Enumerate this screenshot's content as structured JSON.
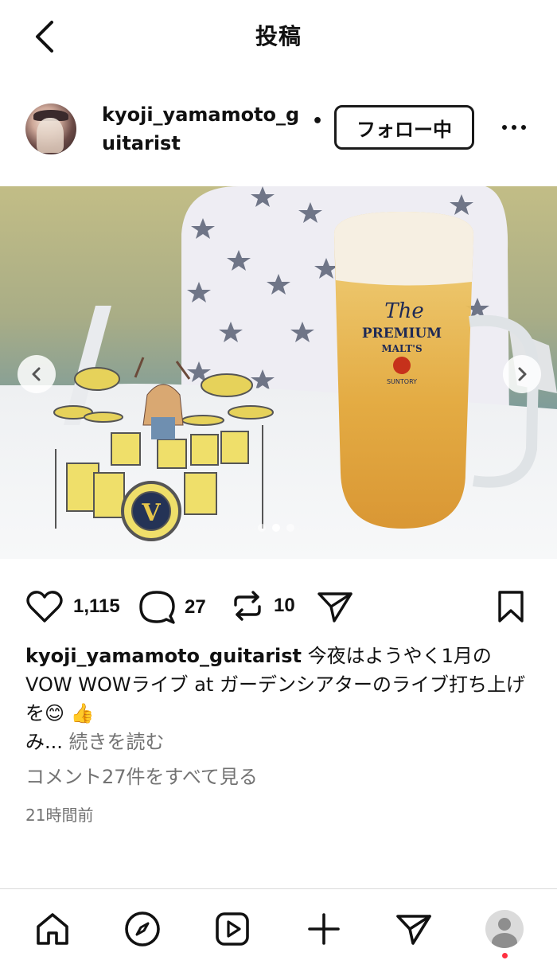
{
  "header": {
    "title": "投稿",
    "back_icon": "chevron-left-icon"
  },
  "post": {
    "username": "kyoji_yamamoto_guitarist",
    "separator": "•",
    "follow_label": "フォロー中",
    "more_icon": "more-horizontal-icon"
  },
  "carousel": {
    "image_description_icon": "photo-drum-kit-and-beer",
    "beer_text_line1": "The",
    "beer_text_line2": "PREMIUM",
    "beer_text_line3": "MALT'S",
    "beer_text_line4": "SUNTORY",
    "slide_count": 3,
    "active_slide": 2
  },
  "actions": {
    "likes": "1,115",
    "comments": "27",
    "reposts": "10"
  },
  "caption": {
    "username": "kyoji_yamamoto_guitarist",
    "text": " 今夜はようやく1月のVOW WOWライブ at ガーデンシアターのライブ打ち上げを😊 👍",
    "truncated": "み...",
    "more_label": " 続きを読む"
  },
  "view_comments": "コメント27件をすべて見る",
  "timestamp": "21時間前",
  "colors": {
    "text": "#111111",
    "secondary": "#737373",
    "notification": "#ff3040"
  }
}
